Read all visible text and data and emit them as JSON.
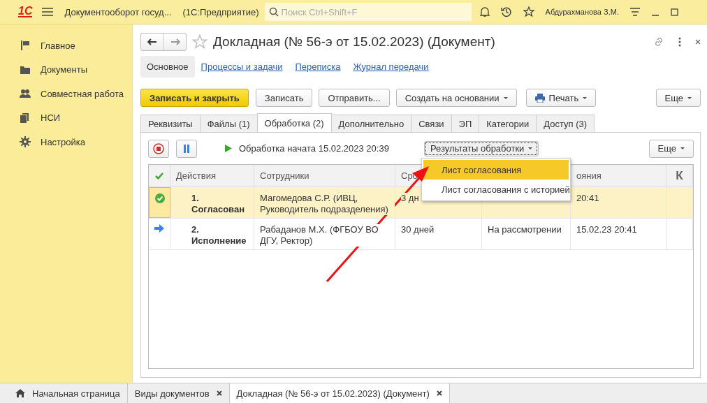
{
  "top_bar": {
    "logo": "1С",
    "app_title": "Документооборот госуд...",
    "platform": "(1С:Предприятие)",
    "search": {
      "placeholder": "Поиск Ctrl+Shift+F"
    },
    "user": "Абдурахманова З.М."
  },
  "sidebar": {
    "items": [
      {
        "label": "Главное",
        "kind": "flag"
      },
      {
        "label": "Документы",
        "kind": "folder"
      },
      {
        "label": "Совместная работа",
        "kind": "people"
      },
      {
        "label": "НСИ",
        "kind": "copies"
      },
      {
        "label": "Настройка",
        "kind": "gear"
      }
    ]
  },
  "document": {
    "title": "Докладная (№ 56-э от 15.02.2023) (Документ)",
    "sections": [
      {
        "label": "Основное",
        "selected": true
      },
      {
        "label": "Процессы и задачи",
        "selected": false
      },
      {
        "label": "Переписка",
        "selected": false
      },
      {
        "label": "Журнал передачи",
        "selected": false
      }
    ],
    "toolbar": [
      {
        "label": "Записать и закрыть",
        "kind": "primary",
        "dropdown": false
      },
      {
        "label": "Записать",
        "kind": "plain",
        "dropdown": false
      },
      {
        "label": "Отправить...",
        "kind": "plain",
        "dropdown": false
      },
      {
        "label": "Создать на основании",
        "kind": "plain",
        "dropdown": true
      },
      {
        "label": "Печать",
        "kind": "print",
        "dropdown": true
      }
    ],
    "more": "Еще",
    "tabs": [
      {
        "label": "Реквизиты",
        "selected": false
      },
      {
        "label": "Файлы (1)",
        "selected": false
      },
      {
        "label": "Обработка (2)",
        "selected": true
      },
      {
        "label": "Дополнительно",
        "selected": false
      },
      {
        "label": "Связи",
        "selected": false
      },
      {
        "label": "ЭП",
        "selected": false
      },
      {
        "label": "Категории",
        "selected": false
      },
      {
        "label": "Доступ (3)",
        "selected": false
      }
    ],
    "process": {
      "status": "Обработка начата 15.02.2023 20:39",
      "results_button": "Результаты обработки",
      "more": "Еще",
      "results_menu": [
        {
          "label": "Лист согласования",
          "selected": true
        },
        {
          "label": "Лист согласования с историей",
          "selected": false
        }
      ]
    },
    "table": {
      "columns": [
        "Действия",
        "Сотрудники",
        "Сро",
        "",
        "ояния",
        "К"
      ],
      "rows": [
        {
          "kind": "done",
          "selected": true,
          "action_number": "1.",
          "action": "Согласован",
          "employee": "Магомедова С.Р. (ИВЦ, Руководитель подразделения)",
          "column_3": "3 дн",
          "column_4": "",
          "column_5": "20:41"
        },
        {
          "kind": "current",
          "selected": false,
          "action_number": "2.",
          "action": "Исполнение",
          "employee": "Рабаданов М.Х. (ФГБОУ ВО ДГУ, Ректор)",
          "column_3": "30 дней",
          "column_4": "На рассмотрении",
          "column_5": "15.02.23 20:41"
        }
      ]
    }
  },
  "open_tabs": [
    {
      "label": "Начальная страница",
      "kind": "home",
      "selected": false
    },
    {
      "label": "Виды документов",
      "kind": "closable",
      "selected": false
    },
    {
      "label": "Докладная (№ 56-э от 15.02.2023) (Документ)",
      "kind": "closable",
      "selected": true
    }
  ]
}
